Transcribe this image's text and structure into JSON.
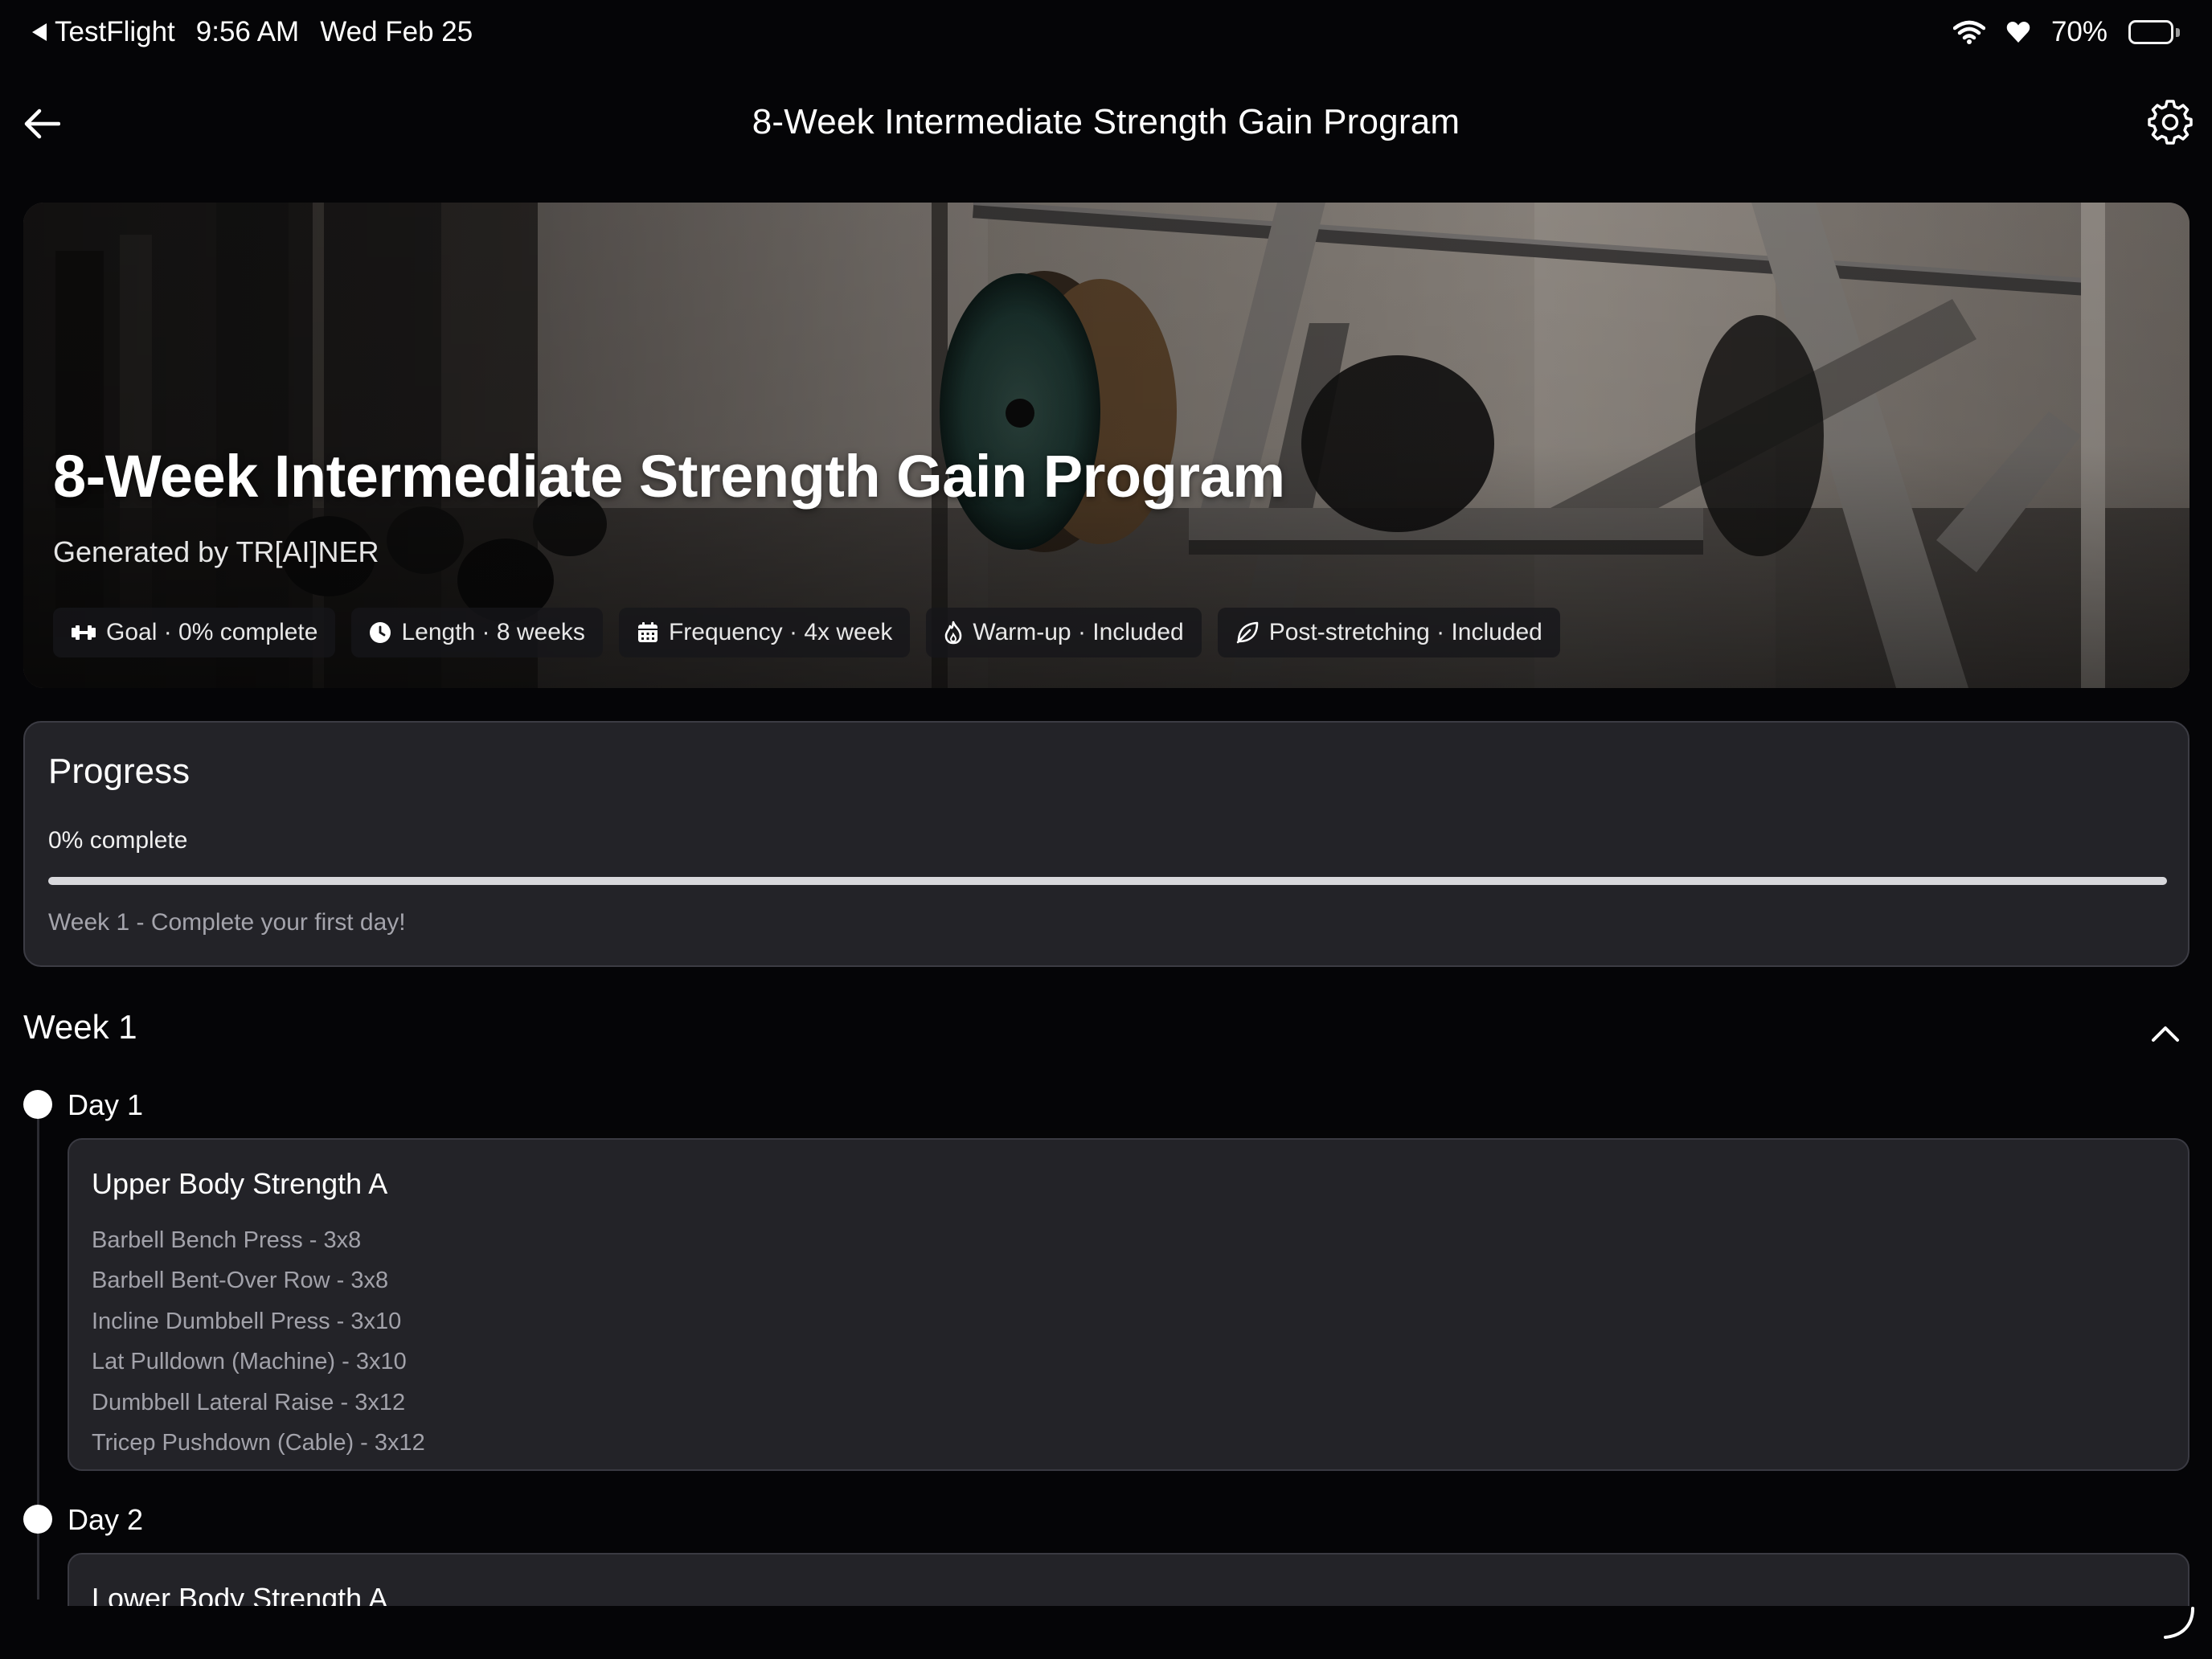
{
  "status_bar": {
    "back_app": "TestFlight",
    "time": "9:56 AM",
    "date": "Wed Feb 25",
    "battery": "70%"
  },
  "header": {
    "title": "8-Week Intermediate Strength Gain Program"
  },
  "hero": {
    "title": "8-Week Intermediate Strength Gain Program",
    "subtitle": "Generated by TR[AI]NER",
    "chips": [
      {
        "icon": "dumbbell-icon",
        "label": "Goal · 0% complete"
      },
      {
        "icon": "clock-icon",
        "label": "Length · 8 weeks"
      },
      {
        "icon": "calendar-icon",
        "label": "Frequency · 4x week"
      },
      {
        "icon": "flame-icon",
        "label": "Warm-up · Included"
      },
      {
        "icon": "leaf-icon",
        "label": "Post-stretching · Included"
      }
    ]
  },
  "progress": {
    "title": "Progress",
    "percent_label": "0% complete",
    "value": 0,
    "note": "Week 1 - Complete your first day!"
  },
  "week": {
    "title": "Week 1",
    "days": [
      {
        "label": "Day 1",
        "workout": "Upper Body Strength A",
        "exercises": [
          "Barbell Bench Press - 3x8",
          "Barbell Bent-Over Row - 3x8",
          "Incline Dumbbell Press - 3x10",
          "Lat Pulldown (Machine) - 3x10",
          "Dumbbell Lateral Raise - 3x12",
          "Tricep Pushdown (Cable) - 3x12"
        ]
      },
      {
        "label": "Day 2",
        "workout": "Lower Body Strength A",
        "exercises": []
      }
    ]
  },
  "colors": {
    "background": "#050507",
    "card": "#232328",
    "card_border": "#3c3c44",
    "muted_text": "#a2a2aa",
    "progress_track": "#d8d8dc"
  }
}
